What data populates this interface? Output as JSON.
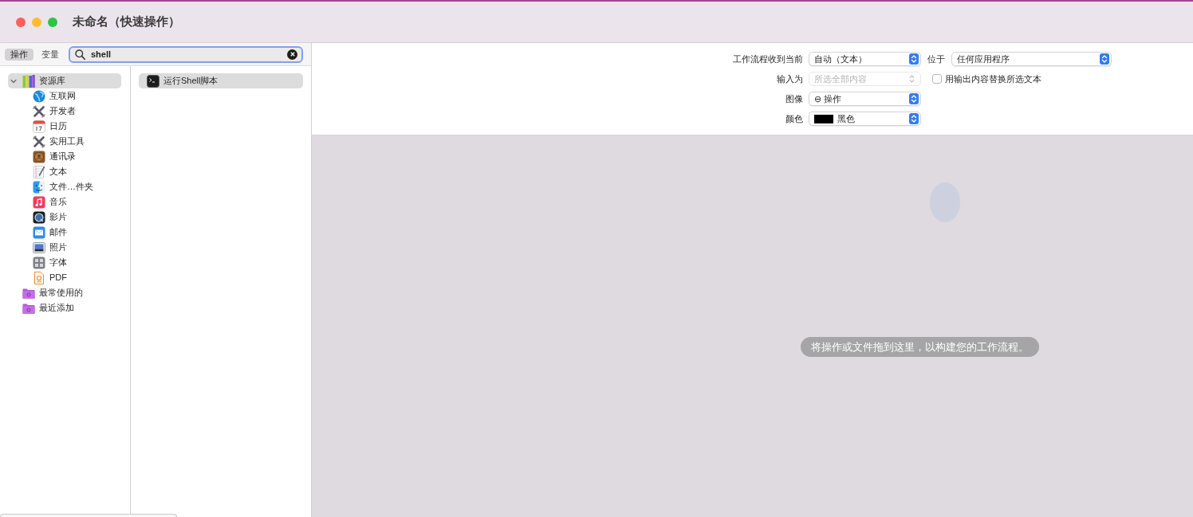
{
  "window": {
    "title": "未命名（快速操作）"
  },
  "library_panel": {
    "tabs": [
      {
        "label": "操作",
        "selected": true
      },
      {
        "label": "变量",
        "selected": false
      }
    ],
    "search": {
      "value": "shell",
      "focused": true
    },
    "tree": [
      {
        "label": "资源库",
        "expanded": true,
        "selected": true,
        "children": [
          {
            "label": "互联网",
            "selected": false
          },
          {
            "label": "开发者",
            "selected": false
          },
          {
            "label": "日历",
            "selected": false
          },
          {
            "label": "实用工具",
            "selected": false
          },
          {
            "label": "通讯录",
            "selected": false
          },
          {
            "label": "文本",
            "selected": false
          },
          {
            "label": "文件…件夹",
            "selected": false
          },
          {
            "label": "音乐",
            "selected": false
          },
          {
            "label": "影片",
            "selected": false
          },
          {
            "label": "邮件",
            "selected": false
          },
          {
            "label": "照片",
            "selected": false
          },
          {
            "label": "字体",
            "selected": false
          },
          {
            "label": "PDF",
            "selected": false
          }
        ]
      },
      {
        "label": "最常使用的",
        "selected": false
      },
      {
        "label": "最近添加",
        "selected": false
      }
    ],
    "actions": [
      {
        "label": "运行Shell脚本",
        "selected": true
      }
    ]
  },
  "workflow_settings": {
    "rows": [
      {
        "label": "工作流程收到当前",
        "popup": {
          "value": "自动（文本）",
          "disabled": false
        },
        "side": {
          "kind": "popup",
          "label": "位于",
          "value": "任何应用程序",
          "disabled": false
        }
      },
      {
        "label": "输入为",
        "popup": {
          "value": "所选全部内容",
          "disabled": true
        },
        "side": {
          "kind": "checkbox",
          "label": "用输出内容替换所选文本",
          "checked": false
        }
      },
      {
        "label": "图像",
        "popup": {
          "value": "⊖ 操作",
          "disabled": false
        }
      },
      {
        "label": "颜色",
        "popup": {
          "value": "黑色",
          "disabled": false,
          "color": "#000000"
        }
      }
    ]
  },
  "canvas": {
    "hint": "将操作或文件拖到这里，以构建您的工作流程。"
  }
}
